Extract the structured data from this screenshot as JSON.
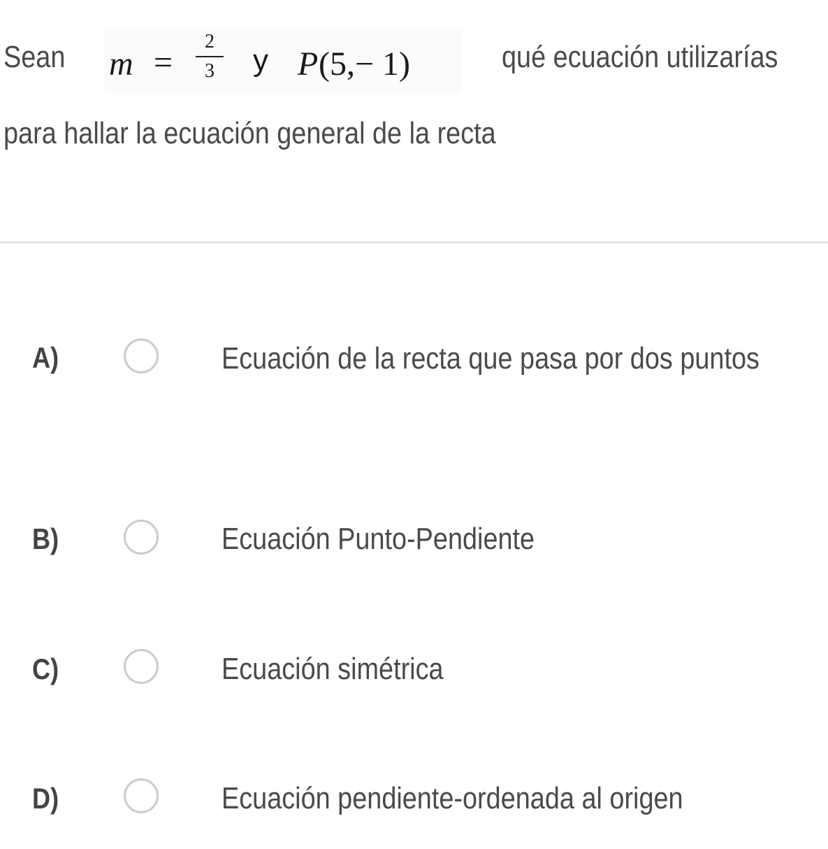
{
  "question": {
    "prefix": "Sean",
    "math": {
      "variable": "m",
      "equals": "=",
      "numerator": "2",
      "denominator": "3",
      "connector": "y",
      "point_name": "P",
      "point_coords": "(5,− 1)"
    },
    "suffix": "qué ecuación utilizarías",
    "line2": "para hallar la ecuación general de la recta"
  },
  "options": [
    {
      "letter": "A)",
      "text": "Ecuación de la recta que pasa por dos puntos",
      "selected": false
    },
    {
      "letter": "B)",
      "text": "Ecuación Punto-Pendiente",
      "selected": false
    },
    {
      "letter": "C)",
      "text": "Ecuación simétrica",
      "selected": false
    },
    {
      "letter": "D)",
      "text": "Ecuación pendiente-ordenada al origen",
      "selected": false
    }
  ],
  "colors": {
    "text": "#4a4a4a",
    "radio_border": "#cccccc",
    "divider": "#e2e2e2"
  }
}
